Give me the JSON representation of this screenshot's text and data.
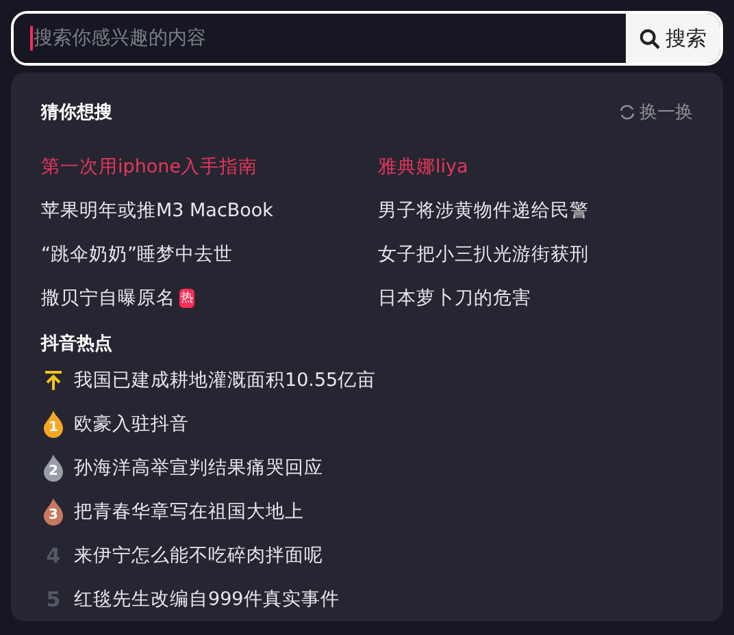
{
  "search": {
    "placeholder": "搜索你感兴趣的内容",
    "button": "搜索"
  },
  "guess": {
    "title": "猜你想搜",
    "refresh": "换一换",
    "items": [
      {
        "text": "第一次用iphone入手指南",
        "highlight": true
      },
      {
        "text": "雅典娜liya",
        "highlight": true
      },
      {
        "text": "苹果明年或推M3 MacBook",
        "highlight": false
      },
      {
        "text": "男子将涉黄物件递给民警",
        "highlight": false
      },
      {
        "text": "“跳伞奶奶”睡梦中去世",
        "highlight": false
      },
      {
        "text": "女子把小三扒光游街获刑",
        "highlight": false
      },
      {
        "text": "撒贝宁自曝原名",
        "highlight": false,
        "badge": "热"
      },
      {
        "text": "日本萝卜刀的危害",
        "highlight": false
      }
    ]
  },
  "hot": {
    "title": "抖音热点",
    "items": [
      {
        "kind": "pinned",
        "text": "我国已建成耕地灌溉面积10.55亿亩"
      },
      {
        "kind": "medal",
        "rank": "1",
        "color": "#f5a623",
        "text": "欧豪入驻抖音"
      },
      {
        "kind": "medal",
        "rank": "2",
        "color": "#9a9ca6",
        "text": "孙海洋高举宣判结果痛哭回应"
      },
      {
        "kind": "medal",
        "rank": "3",
        "color": "#c9785e",
        "text": "把青春华章写在祖国大地上"
      },
      {
        "kind": "number",
        "rank": "4",
        "text": "来伊宁怎么能不吃碎肉拌面呢"
      },
      {
        "kind": "number",
        "rank": "5",
        "text": "红毯先生改编自999件真实事件"
      }
    ]
  }
}
